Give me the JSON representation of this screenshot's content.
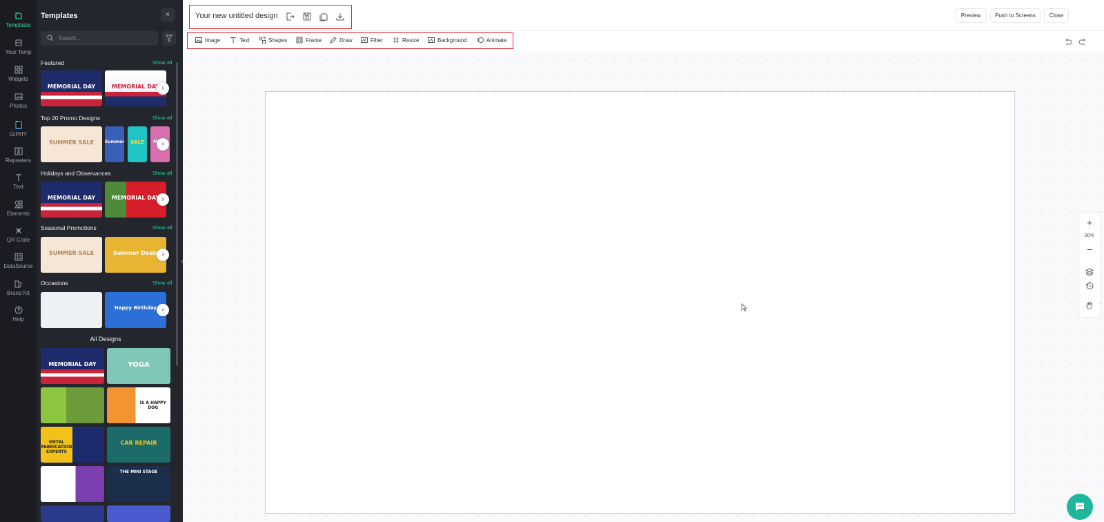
{
  "rail": {
    "items": [
      {
        "label": "Templates",
        "icon": "templates-icon",
        "active": true
      },
      {
        "label": "Your Temp",
        "icon": "your-templates-icon"
      },
      {
        "label": "Widgets",
        "icon": "widgets-icon"
      },
      {
        "label": "Photos",
        "icon": "photos-icon"
      },
      {
        "label": "GIPHY",
        "icon": "giphy-icon"
      },
      {
        "label": "Repeaters",
        "icon": "repeaters-icon"
      },
      {
        "label": "Text",
        "icon": "text-icon"
      },
      {
        "label": "Elements",
        "icon": "elements-icon"
      },
      {
        "label": "QR Code",
        "icon": "qr-code-icon"
      },
      {
        "label": "DataSource",
        "icon": "datasource-icon"
      },
      {
        "label": "Brand Kit",
        "icon": "brand-kit-icon"
      },
      {
        "label": "Help",
        "icon": "help-icon"
      }
    ]
  },
  "panel": {
    "title": "Templates",
    "close_label": "×",
    "search_placeholder": "Search...",
    "show_all_label": "Show all",
    "sections": [
      {
        "title": "Featured",
        "thumbs": [
          "MEMORIAL DAY",
          "MEMORIAL DAY"
        ]
      },
      {
        "title": "Top 20 Promo Designs",
        "thumbs": [
          "SUMMER SALE",
          "Summer",
          "SALE",
          "MEGA"
        ]
      },
      {
        "title": "Holidays and Observances",
        "thumbs": [
          "MEMORIAL DAY",
          "MEMORIAL DAY"
        ]
      },
      {
        "title": "Seasonal Promotions",
        "thumbs": [
          "SUMMER SALE",
          "Summer Deals"
        ]
      },
      {
        "title": "Occasions",
        "thumbs": [
          "",
          "Happy Birthday"
        ]
      }
    ],
    "all_designs_title": "All Designs",
    "all_designs": [
      "MEMORIAL DAY",
      "YOGA",
      "",
      "IS A HAPPY DOG",
      "METAL FABRICATION EXPERTS",
      "CAR REPAIR",
      "",
      "THE MINI STAGE"
    ]
  },
  "header": {
    "design_title": "Your new untitled design",
    "preview_label": "Preview",
    "push_label": "Push to Screens",
    "close_label": "Close"
  },
  "toolbar": {
    "tools": [
      {
        "label": "Image",
        "icon": "image-icon"
      },
      {
        "label": "Text",
        "icon": "text-tool-icon"
      },
      {
        "label": "Shapes",
        "icon": "shapes-icon"
      },
      {
        "label": "Frame",
        "icon": "frame-icon"
      },
      {
        "label": "Draw",
        "icon": "pencil-icon"
      },
      {
        "label": "Filter",
        "icon": "filter-icon"
      },
      {
        "label": "Resize",
        "icon": "resize-icon"
      },
      {
        "label": "Background",
        "icon": "background-icon"
      },
      {
        "label": "Animate",
        "icon": "animate-icon"
      }
    ]
  },
  "zoom": {
    "plus": "+",
    "level": "90%",
    "minus": "−"
  },
  "colors": {
    "accent": "#2fd39c",
    "highlight": "#e3262e",
    "chat": "#1fb79b",
    "rail_bg": "#1a1c22",
    "panel_bg": "#23262d"
  }
}
